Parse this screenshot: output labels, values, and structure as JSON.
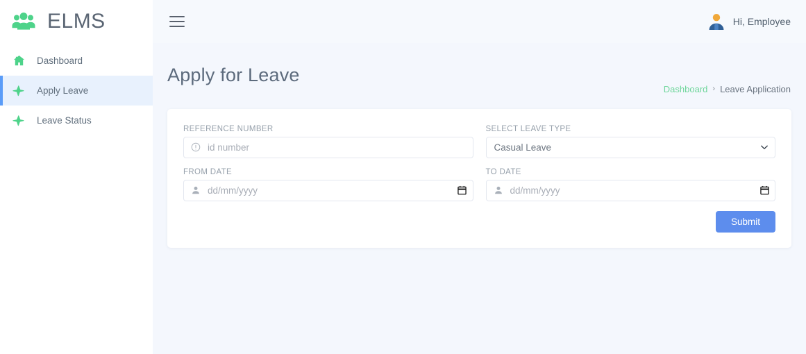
{
  "brand": {
    "name": "ELMS",
    "logo_icon": "users-group-icon",
    "logo_color": "#4ed38a"
  },
  "sidebar": {
    "items": [
      {
        "label": "Dashboard",
        "icon": "home-icon",
        "active": false
      },
      {
        "label": "Apply Leave",
        "icon": "plane-icon",
        "active": true
      },
      {
        "label": "Leave Status",
        "icon": "plane-icon",
        "active": false
      }
    ],
    "active_bg": "#e8f1fd",
    "active_accent": "#5a9cf8"
  },
  "topbar": {
    "menu_icon": "hamburger-icon",
    "avatar_icon": "user-avatar-icon",
    "greeting": "Hi, Employee"
  },
  "page": {
    "title": "Apply for Leave",
    "breadcrumb": {
      "home": "Dashboard",
      "separator": "›",
      "current": "Leave Application"
    }
  },
  "form": {
    "reference_number": {
      "label": "REFERENCE NUMBER",
      "placeholder": "id number",
      "value": "",
      "icon": "info-circle-icon"
    },
    "leave_type": {
      "label": "SELECT LEAVE TYPE",
      "value": "Casual Leave",
      "chevron_icon": "chevron-down-icon"
    },
    "from_date": {
      "label": "FROM DATE",
      "placeholder": "dd/mm/yyyy",
      "value": "",
      "icon": "person-icon",
      "picker_icon": "calendar-icon"
    },
    "to_date": {
      "label": "TO DATE",
      "placeholder": "dd/mm/yyyy",
      "value": "",
      "icon": "person-icon",
      "picker_icon": "calendar-icon"
    },
    "submit_label": "Submit",
    "submit_color": "#5d8ded"
  }
}
